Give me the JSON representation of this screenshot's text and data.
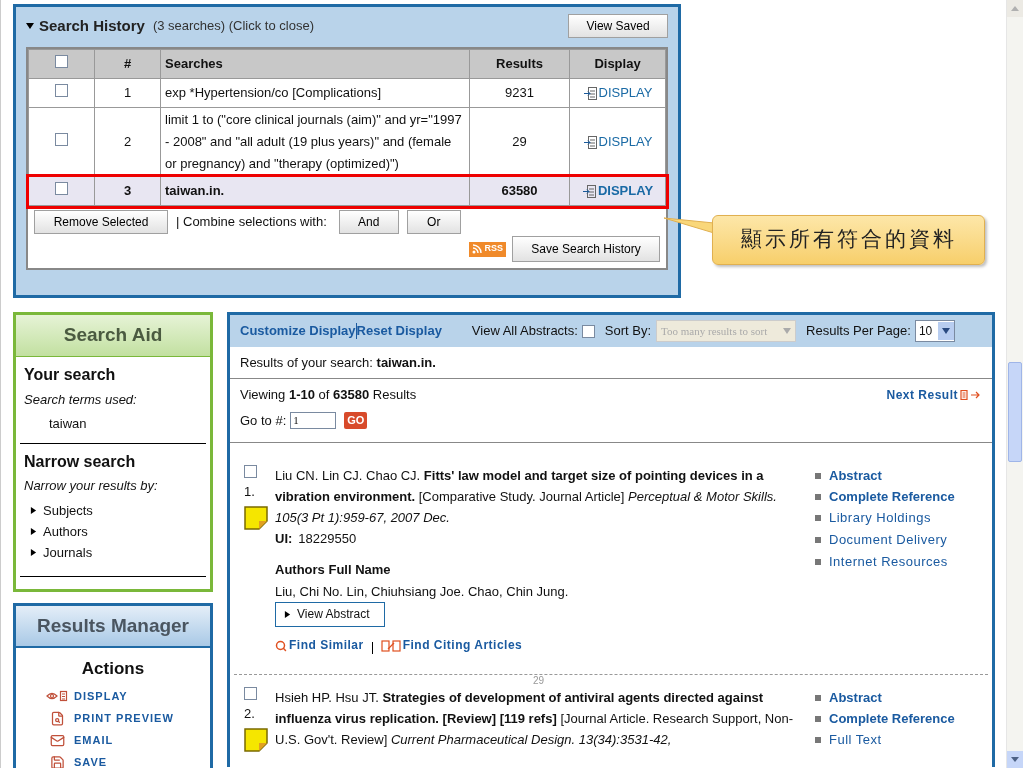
{
  "search_history": {
    "title": "Search History",
    "summary": "(3 searches) (Click to close)",
    "expanded": true,
    "view_saved_button": "View Saved",
    "columns": [
      "#",
      "Searches",
      "Results",
      "Display"
    ],
    "select_all_checked": false,
    "rows": [
      {
        "checked": false,
        "number": "1",
        "query": "exp *Hypertension/co [Complications]",
        "results": "9231",
        "display": "DISPLAY",
        "selected": false
      },
      {
        "checked": false,
        "number": "2",
        "query": "limit 1 to (\"core clinical journals (aim)\" and yr=\"1997 - 2008\" and \"all adult (19 plus years)\" and (female or pregnancy) and \"therapy (optimized)\")",
        "results": "29",
        "display": "DISPLAY",
        "selected": false
      },
      {
        "checked": false,
        "number": "3",
        "query": "taiwan.in.",
        "results": "63580",
        "display": "DISPLAY",
        "selected": true
      }
    ],
    "remove_button": "Remove Selected",
    "combine_label": "| Combine selections with:",
    "and_button": "And",
    "or_button": "Or",
    "rss_badge": "RSS",
    "save_button": "Save Search History"
  },
  "callout": {
    "text": "顯示所有符合的資料"
  },
  "search_aid": {
    "title": "Search Aid",
    "your_search_heading": "Your search",
    "terms_label": "Search terms used:",
    "term": "taiwan",
    "narrow_heading": "Narrow search",
    "narrow_label": "Narrow your results by:",
    "facets": [
      {
        "label": "Subjects",
        "expanded": false
      },
      {
        "label": "Authors",
        "expanded": false
      },
      {
        "label": "Journals",
        "expanded": false
      }
    ]
  },
  "results_manager": {
    "title": "Results Manager",
    "actions_heading": "Actions",
    "actions": [
      {
        "label": "DISPLAY",
        "kind": "display"
      },
      {
        "label": "PRINT PREVIEW",
        "kind": "print"
      },
      {
        "label": "EMAIL",
        "kind": "email"
      },
      {
        "label": "SAVE",
        "kind": "save"
      }
    ]
  },
  "results": {
    "customize_link": "Customize Display",
    "reset_link": "Reset Display",
    "view_all_label": "View All Abstracts:",
    "view_all_checked": false,
    "sort_label": "Sort By:",
    "sort_value": "Too many results to sort",
    "sort_disabled": true,
    "per_page_label": "Results Per Page:",
    "per_page_value": "10",
    "search_line": "Results of your search: **taiwan.in.**",
    "viewing": "Viewing **1-10** of **63580** Results",
    "next_result": "Next Result",
    "goto_label": "Go to #:",
    "goto_value": "1",
    "go_button": "GO",
    "records": [
      {
        "checked": false,
        "number": "1.",
        "citation": "Liu CN. Lin CJ. Chao CJ. **Fitts' law model and target size of pointing devices in a vibration environment.** [Comparative Study. Journal Article] *Perceptual & Motor Skills. 105(3 Pt 1):959-67, 2007 Dec.*",
        "ui_label": "UI:",
        "ui": "18229550",
        "authors_heading": "Authors Full Name",
        "authors_full": "Liu, Chi No. Lin, Chiuhsiang Joe. Chao, Chin Jung.",
        "view_abstract": "View Abstract",
        "find_similar": "Find Similar",
        "find_citing": "Find Citing Articles",
        "links": [
          {
            "label": "Abstract",
            "kind": "primary"
          },
          {
            "label": "Complete Reference",
            "kind": "primary"
          },
          {
            "label": "Library Holdings",
            "kind": "secondary"
          },
          {
            "label": "Document Delivery",
            "kind": "secondary"
          },
          {
            "label": "Internet Resources",
            "kind": "secondary"
          }
        ]
      },
      {
        "checked": false,
        "number": "2.",
        "citation": "Hsieh HP. Hsu JT. **Strategies of development of antiviral agents directed against influenza virus replication. [Review] [119 refs]** [Journal Article. Research Support, Non-U.S. Gov't. Review] *Current Pharmaceutical Design. 13(34):3531-42,*",
        "links": [
          {
            "label": "Abstract",
            "kind": "primary"
          },
          {
            "label": "Complete Reference",
            "kind": "primary"
          },
          {
            "label": "Full Text",
            "kind": "secondary"
          }
        ]
      }
    ]
  },
  "page_number": "29"
}
